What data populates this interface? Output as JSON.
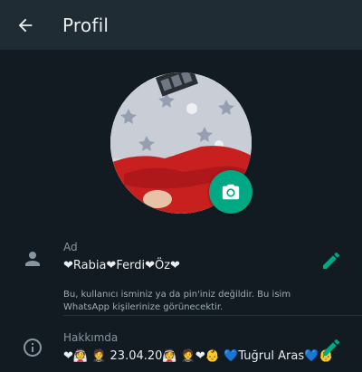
{
  "appbar": {
    "title": "Profil"
  },
  "name_row": {
    "label": "Ad",
    "value": "❤Rabia❤Ferdi❤Öz❤",
    "hint": "Bu, kullanıcı isminiz ya da pin'iniz değildir. Bu isim WhatsApp kişilerinize görünecektir."
  },
  "about_row": {
    "label": "Hakkımda",
    "value": "❤👰 🤵 23.04.20👰 🤵❤👶 💙Tuğrul Aras💙👶"
  },
  "colors": {
    "background": "#121b22",
    "appbar": "#1f2c34",
    "accent": "#00a884",
    "secondary_text": "#8696a0"
  },
  "icons": {
    "back": "arrow-left-icon",
    "camera": "camera-icon",
    "person": "person-icon",
    "info": "info-icon",
    "edit": "pencil-icon"
  }
}
